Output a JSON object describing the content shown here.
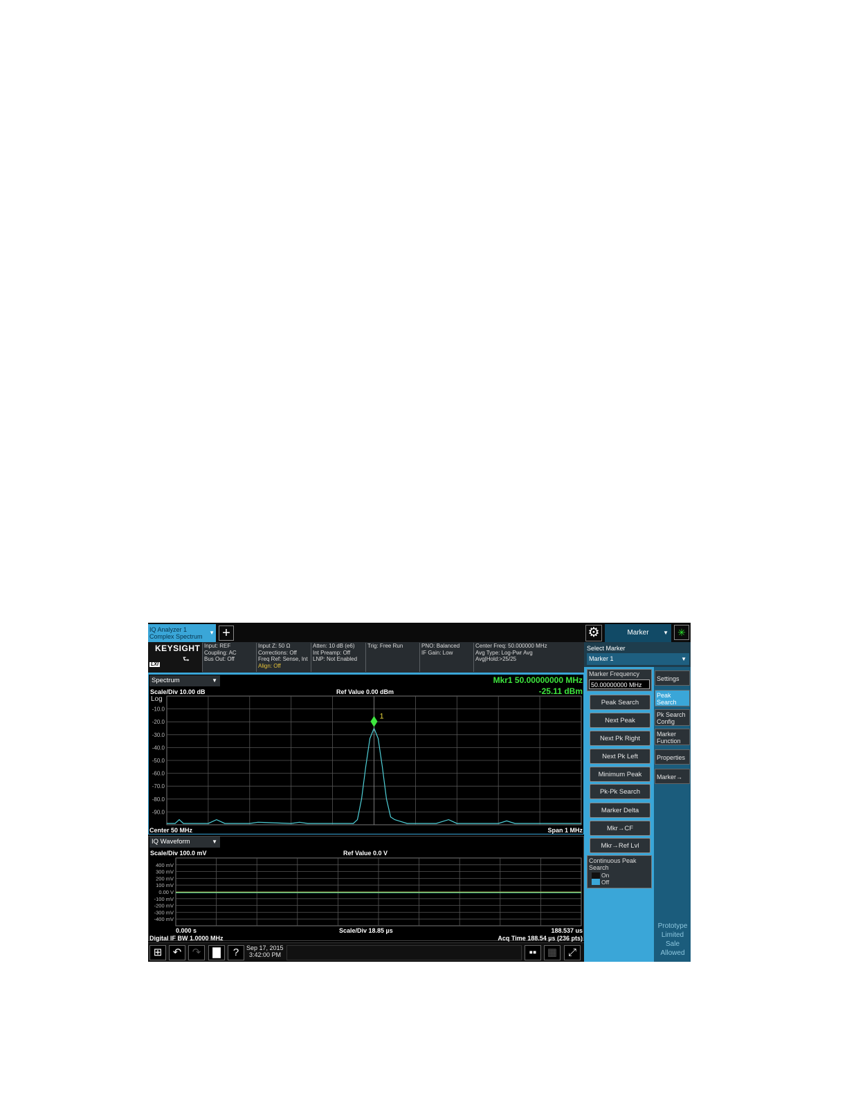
{
  "topbar": {
    "tab_title_line1": "IQ Analyzer 1",
    "tab_title_line2": "Complex Spectrum",
    "add_icon": "plus-icon",
    "settings_icon": "gear-icon",
    "menu": "Marker",
    "status_icon": "sweep-status-icon"
  },
  "infobar": {
    "brand": "KEYSIGHT",
    "brand_badge": "LXI",
    "col1": [
      "Input: REF",
      "Coupling: AC",
      "Bus Out: Off"
    ],
    "col2": [
      "Input Z: 50 Ω",
      "Corrections: Off",
      "Freq Ref: Sense, Int"
    ],
    "col2_align": "Align: Off",
    "col3": [
      "Atten: 10 dB (e6)",
      "Int Preamp: Off",
      "LNP: Not Enabled"
    ],
    "col4": [
      "Trig: Free Run"
    ],
    "col5": [
      "PNO: Balanced",
      "IF Gain: Low"
    ],
    "col6": [
      "Center Freq: 50.000000 MHz",
      "Avg Type: Log-Pwr Avg",
      "Avg|Hold:>25/25"
    ]
  },
  "spectrum": {
    "window": "Spectrum",
    "marker_freq": "Mkr1  50.00000000 MHz",
    "marker_amp": "-25.11 dBm",
    "scale": "Scale/Div 10.00 dB",
    "ref": "Ref Value 0.00 dBm",
    "scale_type": "Log",
    "center": "Center 50 MHz",
    "span": "Span 1 MHz",
    "marker_label": "1"
  },
  "waveform": {
    "window": "IQ Waveform",
    "scale": "Scale/Div 100.0 mV",
    "ref": "Ref Value 0.0 V",
    "start": "0.000 s",
    "mid": "Scale/Div 18.85 µs",
    "end": "188.537 us",
    "if_bw": "Digital IF BW 1.0000 MHz",
    "acq": "Acq Time 188.54 µs (236 pts)"
  },
  "chart_data": [
    {
      "type": "line",
      "ylabel": "Log",
      "yticks": [
        "-10.0",
        "-20.0",
        "-30.0",
        "-40.0",
        "-50.0",
        "-60.0",
        "-70.0",
        "-80.0",
        "-90.0"
      ],
      "ylim": [
        -100,
        0
      ],
      "xlim": [
        49.5,
        50.5
      ],
      "grid": true,
      "series": [
        {
          "color": "#4fd0d8",
          "x": [
            49.5,
            49.52,
            49.53,
            49.54,
            49.6,
            49.62,
            49.64,
            49.7,
            49.72,
            49.8,
            49.82,
            49.84,
            49.9,
            49.92,
            49.95,
            49.96,
            49.97,
            49.98,
            49.99,
            50.0,
            50.01,
            50.02,
            50.03,
            50.04,
            50.05,
            50.06,
            50.08,
            50.1,
            50.15,
            50.18,
            50.2,
            50.22,
            50.3,
            50.32,
            50.34,
            50.4,
            50.45,
            50.5
          ],
          "y": [
            -99,
            -99,
            -96,
            -99,
            -99,
            -96,
            -99,
            -99,
            -98,
            -99,
            -98,
            -99,
            -99,
            -99,
            -99,
            -96,
            -80,
            -55,
            -33,
            -25,
            -33,
            -55,
            -80,
            -94,
            -96,
            -97,
            -99,
            -99,
            -99,
            -96,
            -99,
            -99,
            -99,
            -97,
            -99,
            -99,
            -99,
            -99
          ]
        }
      ],
      "markers": [
        {
          "label": "1",
          "x": 50.0,
          "y": -25.11
        }
      ]
    },
    {
      "type": "line",
      "yticks": [
        "400 mV",
        "300 mV",
        "200 mV",
        "100 mV",
        "0.00 V",
        "-100 mV",
        "-200 mV",
        "-300 mV",
        "-400 mV"
      ],
      "ylim": [
        -500,
        500
      ],
      "xlim": [
        0,
        188.537
      ],
      "grid": true,
      "series": [
        {
          "color": "#e6d23c",
          "x": [
            0,
            188.537
          ],
          "y": [
            -5,
            -5
          ]
        },
        {
          "color": "#43c8a8",
          "x": [
            0,
            188.537
          ],
          "y": [
            -12,
            -12
          ]
        }
      ]
    }
  ],
  "sidepanel": {
    "select_marker_label": "Select Marker",
    "select_marker_value": "Marker 1",
    "marker_freq_label": "Marker Frequency",
    "marker_freq_value": "50.00000000 MHz",
    "buttons": [
      "Peak Search",
      "Next Peak",
      "Next Pk Right",
      "Next Pk Left",
      "Minimum Peak",
      "Pk-Pk Search",
      "Marker Delta",
      "Mkr→CF",
      "Mkr→Ref Lvl"
    ],
    "cps_title_1": "Continuous Peak",
    "cps_title_2": "Search",
    "cps_on": "On",
    "cps_off": "Off",
    "tabs": [
      "Settings",
      "Peak Search",
      "Pk Search Config",
      "Marker Function",
      "Properties",
      "Marker→"
    ],
    "proto": [
      "Prototype",
      "Limited",
      "Sale",
      "Allowed"
    ]
  },
  "taskbar": {
    "icons": [
      "windows-icon",
      "undo-icon",
      "redo-icon",
      "folder-icon",
      "help-icon"
    ],
    "date": "Sep 17, 2015",
    "time": "3:42:00 PM",
    "right_icons": [
      "multi-window-icon",
      "window-layout-icon",
      "fullscreen-icon"
    ]
  }
}
